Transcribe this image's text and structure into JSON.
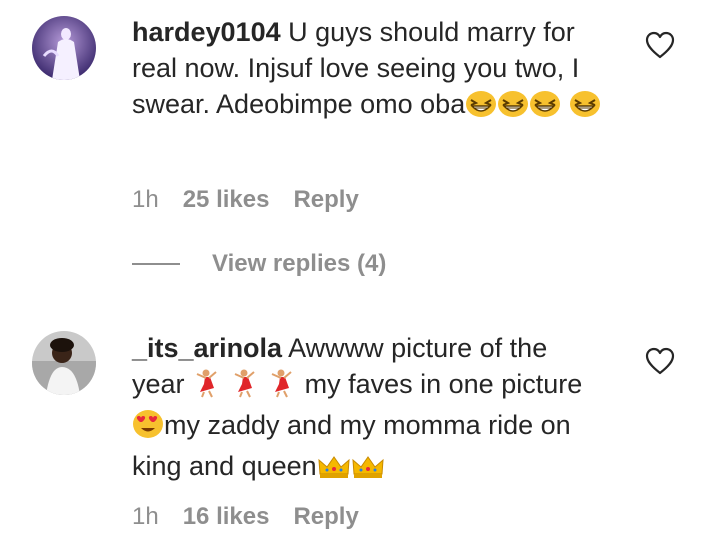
{
  "comments": [
    {
      "username": "hardey0104",
      "text": "U guys should marry for real now. Injsuf love seeing you two, I swear. Adeobimpe omo oba",
      "emojis": [
        "grin-squint-emoji",
        "grin-squint-emoji",
        "grin-squint-emoji",
        "grin-squint-emoji"
      ],
      "time": "1h",
      "likes": "25 likes",
      "reply": "Reply",
      "view_replies": "View replies (4)"
    },
    {
      "username": "_its_arinola",
      "text_1": "Awwww picture of the year",
      "emojis_1": [
        "dancer-emoji",
        "dancer-emoji",
        "dancer-emoji"
      ],
      "text_2": "my faves in one picture",
      "emojis_2": [
        "heart-eyes-emoji"
      ],
      "text_3": "my zaddy and my momma ride on king and queen",
      "emojis_3": [
        "crown-emoji",
        "crown-emoji"
      ],
      "time": "1h",
      "likes": "16 likes",
      "reply": "Reply"
    }
  ],
  "colors": {
    "text": "#262626",
    "muted": "#8e8e8e",
    "background": "#ffffff"
  },
  "icons": {
    "like": "heart-outline-icon"
  }
}
